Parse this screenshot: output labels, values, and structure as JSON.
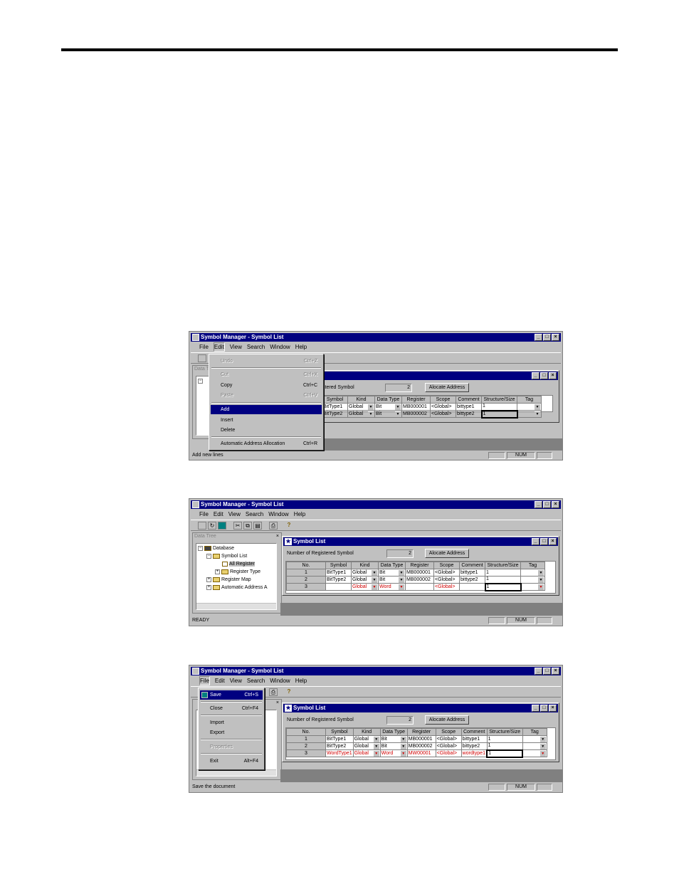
{
  "app": {
    "title": "Symbol Manager - Symbol List",
    "menu": [
      "File",
      "Edit",
      "View",
      "Search",
      "Window",
      "Help"
    ],
    "win_buttons": [
      "_",
      "□",
      "×"
    ]
  },
  "child_window": {
    "title": "Symbol List",
    "count_label": "Number of  Registered Symbol",
    "count_label_partial": "stered Symbol",
    "allocate_button": "Alocate Address"
  },
  "dock": {
    "title": "Data Tree"
  },
  "tree": [
    {
      "label": "Database",
      "level": 0,
      "expander": "−"
    },
    {
      "label": "Symbol List",
      "level": 1,
      "expander": "−"
    },
    {
      "label": "All Register",
      "level": 2,
      "expander": ""
    },
    {
      "label": "Register Type",
      "level": 2,
      "expander": "+"
    },
    {
      "label": "Register Map",
      "level": 1,
      "expander": "+"
    },
    {
      "label": "Automatic Address A",
      "level": 1,
      "expander": "+"
    }
  ],
  "columns": [
    "No.",
    "Symbol",
    "Kind",
    "Data Type",
    "Register",
    "Scope",
    "Comment",
    "Structure/Size",
    "Tag"
  ],
  "screen1": {
    "edit_menu": [
      {
        "label": "Undo",
        "shortcut": "Ctrl+Z",
        "disabled": true
      },
      {
        "label": "Cut",
        "shortcut": "Ctrl+X",
        "disabled": true
      },
      {
        "label": "Copy",
        "shortcut": "Ctrl+C",
        "disabled": false
      },
      {
        "label": "Paste",
        "shortcut": "Ctrl+V",
        "disabled": true
      },
      {
        "label": "Add",
        "shortcut": "",
        "disabled": false
      },
      {
        "label": "Insert",
        "shortcut": "",
        "disabled": false
      },
      {
        "label": "Delete",
        "shortcut": "",
        "disabled": false
      },
      {
        "label": "Automatic Address Allocation",
        "shortcut": "Ctrl+R",
        "disabled": false
      }
    ],
    "count": "2",
    "rows": [
      {
        "symbol": "BitType1",
        "kind": "Global",
        "dtype": "Bit",
        "register": "MB000001",
        "scope": "<Global>",
        "comment": "bittype1",
        "size": "1"
      },
      {
        "symbol": "BitType2",
        "kind": "Global",
        "dtype": "Bit",
        "register": "MB000002",
        "scope": "<Global>",
        "comment": "bittype2",
        "size": "1"
      }
    ],
    "status": "Add new lines",
    "num": "NUM"
  },
  "screen2": {
    "count": "2",
    "rows": [
      {
        "no": "1",
        "symbol": "BitType1",
        "kind": "Global",
        "dtype": "Bit",
        "register": "MB000001",
        "scope": "<Global>",
        "comment": "bittype1",
        "size": "1"
      },
      {
        "no": "2",
        "symbol": "BitType2",
        "kind": "Global",
        "dtype": "Bit",
        "register": "MB000002",
        "scope": "<Global>",
        "comment": "bittype2",
        "size": "1"
      },
      {
        "no": "3",
        "symbol": "",
        "kind": "Global",
        "dtype": "Word",
        "register": "",
        "scope": "<Global>",
        "comment": "",
        "size": "1"
      }
    ],
    "status": "READY",
    "num": "NUM"
  },
  "screen3": {
    "file_menu": [
      {
        "label": "Save",
        "shortcut": "Ctrl+S",
        "disabled": false
      },
      {
        "label": "Close",
        "shortcut": "Ctrl+F4",
        "disabled": false
      },
      {
        "label": "Import",
        "shortcut": "",
        "disabled": false
      },
      {
        "label": "Export",
        "shortcut": "",
        "disabled": false
      },
      {
        "label": "Properties",
        "shortcut": "",
        "disabled": true
      },
      {
        "label": "Exit",
        "shortcut": "Alt+F4",
        "disabled": false
      }
    ],
    "count": "2",
    "rows": [
      {
        "no": "1",
        "symbol": "BitType1",
        "kind": "Global",
        "dtype": "Bit",
        "register": "MB000001",
        "scope": "<Global>",
        "comment": "bittype1",
        "size": "1"
      },
      {
        "no": "2",
        "symbol": "BitType2",
        "kind": "Global",
        "dtype": "Bit",
        "register": "MB000002",
        "scope": "<Global>",
        "comment": "bittype2",
        "size": "1"
      },
      {
        "no": "3",
        "symbol": "WordType1",
        "kind": "Global",
        "dtype": "Word",
        "register": "MW00001",
        "scope": "<Global>",
        "comment": "wordtype1",
        "size": "1"
      }
    ],
    "tree_visible": [
      "a",
      "s A"
    ],
    "status": "Save the document",
    "num": "NUM"
  },
  "colors": {
    "titlebar": "#000080",
    "face": "#c0c0c0",
    "new_row": "#d00000"
  }
}
